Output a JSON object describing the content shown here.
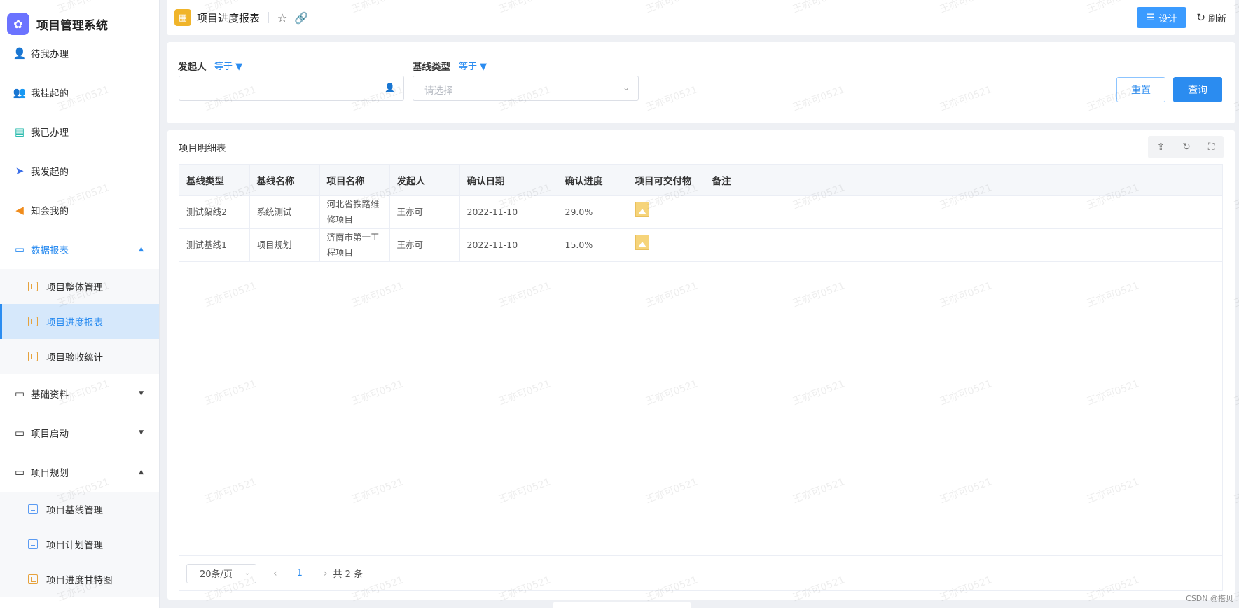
{
  "brand": {
    "title": "项目管理系统"
  },
  "sidebar": {
    "items": [
      {
        "label": "待我办理"
      },
      {
        "label": "我挂起的"
      },
      {
        "label": "我已办理"
      },
      {
        "label": "我发起的"
      },
      {
        "label": "知会我的"
      }
    ],
    "groups": [
      {
        "label": "数据报表",
        "children": [
          "项目整体管理",
          "项目进度报表",
          "项目验收统计"
        ]
      },
      {
        "label": "基础资料"
      },
      {
        "label": "项目启动"
      },
      {
        "label": "项目规划",
        "children": [
          "项目基线管理",
          "项目计划管理",
          "项目进度甘特图"
        ]
      }
    ]
  },
  "header": {
    "title": "项目进度报表",
    "design_label": "设计",
    "refresh_label": "刷新"
  },
  "filter": {
    "field1_label": "发起人",
    "field1_op": "等于",
    "field2_label": "基线类型",
    "field2_op": "等于",
    "field2_placeholder": "请选择",
    "reset_label": "重置",
    "query_label": "查询"
  },
  "table": {
    "title": "项目明细表",
    "columns": [
      "基线类型",
      "基线名称",
      "项目名称",
      "发起人",
      "确认日期",
      "确认进度",
      "项目可交付物",
      "备注"
    ],
    "rows": [
      {
        "baseline_type": "测试架线2",
        "baseline_name": "系统测试",
        "project_name": "河北省铁路维修项目",
        "initiator": "王亦可",
        "confirm_date": "2022-11-10",
        "progress": "29.0%",
        "remark": ""
      },
      {
        "baseline_type": "测试基线1",
        "baseline_name": "项目规划",
        "project_name": "济南市第一工程项目",
        "initiator": "王亦可",
        "confirm_date": "2022-11-10",
        "progress": "15.0%",
        "remark": ""
      }
    ]
  },
  "pagination": {
    "page_size": "20条/页",
    "current_page": "1",
    "total": "共 2 条"
  },
  "watermark_text": "王亦可0521",
  "footer": "CSDN @搭贝",
  "colors": {
    "primary": "#2b8cf0",
    "brand": "#6b73ff",
    "icon_yellow": "#f0b429"
  }
}
